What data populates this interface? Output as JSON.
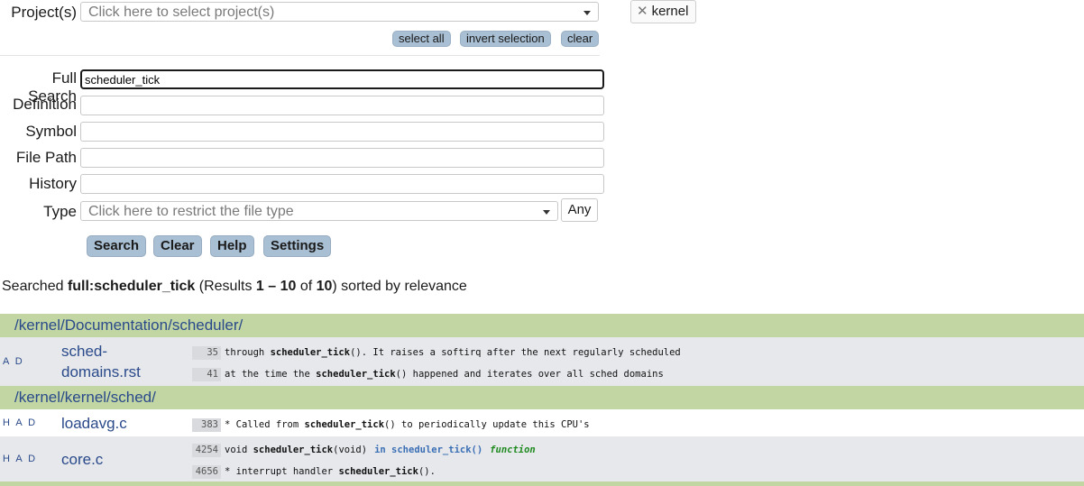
{
  "form": {
    "project_label": "Project(s)",
    "project_placeholder": "Click here to select project(s)",
    "select_all": "select all",
    "invert_selection": "invert selection",
    "clear_small": "clear",
    "selected_project_tag": "kernel",
    "full_search_label": "Full Search",
    "full_search_value": "scheduler_tick",
    "definition_label": "Definition",
    "symbol_label": "Symbol",
    "file_path_label": "File Path",
    "history_label": "History",
    "type_label": "Type",
    "type_placeholder": "Click here to restrict the file type",
    "any_label": "Any",
    "search_btn": "Search",
    "clear_btn": "Clear",
    "help_btn": "Help",
    "settings_btn": "Settings"
  },
  "summary": {
    "prefix": "Searched ",
    "query": "full:scheduler_tick",
    "mid1": " (Results ",
    "range": "1 – 10",
    "mid2": " of ",
    "total": "10",
    "suffix": ") sorted by relevance"
  },
  "results": {
    "dir1": "/kernel/Documentation/scheduler/",
    "file1_flags": "A D",
    "file1_name_a": "sched-",
    "file1_name_b": "domains.rst",
    "file1_l1_num": "35",
    "file1_l1_pre": "through ",
    "file1_l1_hit": "scheduler_tick",
    "file1_l1_post": "(). It raises a softirq after the next regularly scheduled",
    "file1_l2_num": "41",
    "file1_l2_pre": "at the time the ",
    "file1_l2_hit": "scheduler_tick",
    "file1_l2_post": "() happened and iterates over all sched domains",
    "dir2": "/kernel/kernel/sched/",
    "file2_flags": "H A D",
    "file2_name": "loadavg.c",
    "file2_l1_num": "383",
    "file2_l1_pre": "* Called from ",
    "file2_l1_hit": "scheduler_tick",
    "file2_l1_post": "() to periodically update this CPU's",
    "file3_flags": "H A D",
    "file3_name": "core.c",
    "file3_l1_num": "4254",
    "file3_l1_pre": "void ",
    "file3_l1_hit": "scheduler_tick",
    "file3_l1_post": "(void)",
    "file3_l1_scope": "in scheduler_tick()",
    "file3_l1_kind": "function",
    "file3_l2_num": "4656",
    "file3_l2_pre": "* interrupt handler ",
    "file3_l2_hit": "scheduler_tick",
    "file3_l2_post": "()."
  }
}
